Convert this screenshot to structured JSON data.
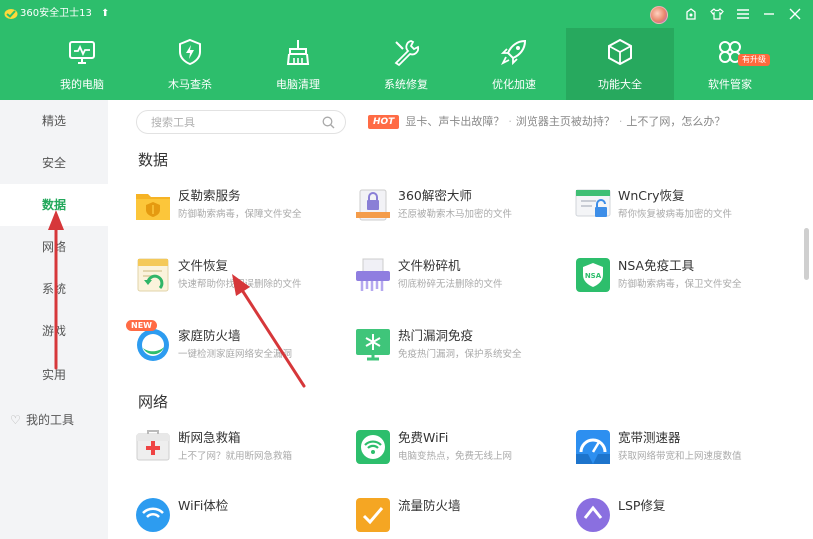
{
  "titlebar": {
    "title": "360安全卫士13",
    "update_glyph": "⬆",
    "icons": [
      "avatar",
      "skin-icon",
      "shirt-icon",
      "menu-icon",
      "minimize-icon",
      "close-icon"
    ]
  },
  "nav": {
    "items": [
      {
        "label": "我的电脑",
        "icon": "monitor-icon"
      },
      {
        "label": "木马查杀",
        "icon": "shield-bolt-icon"
      },
      {
        "label": "电脑清理",
        "icon": "broom-icon"
      },
      {
        "label": "系统修复",
        "icon": "wrench-icon"
      },
      {
        "label": "优化加速",
        "icon": "rocket-icon"
      },
      {
        "label": "功能大全",
        "icon": "cube-icon",
        "active": true
      },
      {
        "label": "软件管家",
        "icon": "clover-icon",
        "badge": "有升级"
      }
    ]
  },
  "sidebar": {
    "items": [
      {
        "label": "精选"
      },
      {
        "label": "安全"
      },
      {
        "label": "数据",
        "active": true
      },
      {
        "label": "网络"
      },
      {
        "label": "系统"
      },
      {
        "label": "游戏"
      },
      {
        "label": "实用"
      }
    ],
    "favorites": "我的工具"
  },
  "search": {
    "placeholder": "搜索工具"
  },
  "hot": {
    "badge": "HOT",
    "links": [
      "显卡、声卡出故障？",
      "浏览器主页被劫持？",
      "上不了网，怎么办？"
    ]
  },
  "sections": [
    {
      "title": "数据",
      "tools": [
        {
          "name": "反勒索服务",
          "desc": "防御勒索病毒，保障文件安全",
          "icon": "folder-shield-icon"
        },
        {
          "name": "360解密大师",
          "desc": "还原被勒索木马加密的文件",
          "icon": "lock-file-icon"
        },
        {
          "name": "WnCry恢复",
          "desc": "帮你恢复被病毒加密的文件",
          "icon": "monitor-lock-icon"
        },
        {
          "name": "文件恢复",
          "desc": "快速帮助你找回误删除的文件",
          "icon": "file-restore-icon"
        },
        {
          "name": "文件粉碎机",
          "desc": "彻底粉碎无法删除的文件",
          "icon": "shredder-icon"
        },
        {
          "name": "NSA免疫工具",
          "desc": "防御勒索病毒，保卫文件安全",
          "icon": "nsa-shield-icon"
        },
        {
          "name": "家庭防火墙",
          "desc": "一键检测家庭网络安全漏洞",
          "icon": "home-firewall-icon",
          "badge": "NEW"
        },
        {
          "name": "热门漏洞免疫",
          "desc": "免疫热门漏洞，保护系统安全",
          "icon": "snowflake-shield-icon"
        }
      ]
    },
    {
      "title": "网络",
      "tools": [
        {
          "name": "断网急救箱",
          "desc": "上不了网？就用断网急救箱",
          "icon": "first-aid-icon"
        },
        {
          "name": "免费WiFi",
          "desc": "电脑变热点，免费无线上网",
          "icon": "wifi-icon"
        },
        {
          "name": "宽带测速器",
          "desc": "获取网络带宽和上网速度数值",
          "icon": "speedometer-icon"
        },
        {
          "name": "WiFi体检",
          "desc": "",
          "icon": "wifi-check-icon"
        },
        {
          "name": "流量防火墙",
          "desc": "",
          "icon": "traffic-firewall-icon"
        },
        {
          "name": "LSP修复",
          "desc": "",
          "icon": "lsp-repair-icon"
        }
      ]
    }
  ],
  "colors": {
    "header_green": "#2dbe6c",
    "active_nav": "#27a95e",
    "sidebar_bg": "#f3f4f6",
    "accent_green": "#23a85b",
    "hot_orange": "#ff6b45",
    "annotation_red": "#d6373a"
  }
}
